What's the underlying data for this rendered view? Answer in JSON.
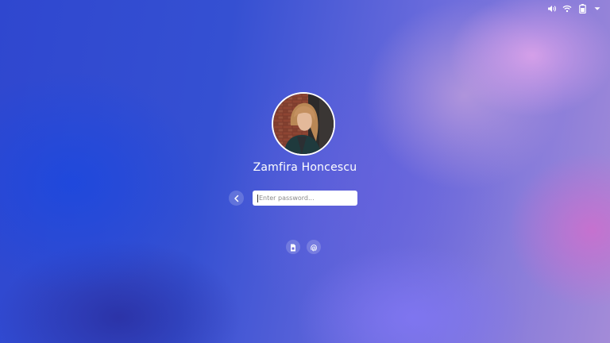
{
  "status_bar": {
    "icons": [
      "volume-icon",
      "wifi-icon",
      "battery-icon",
      "chevron-down-icon"
    ]
  },
  "user": {
    "name": "Zamfira Honcescu"
  },
  "login": {
    "password_placeholder": "Enter password...",
    "password_value": ""
  },
  "auth_methods": [
    "smartcard-icon",
    "fingerprint-icon"
  ],
  "colors": {
    "background_blue": "#2f47cf",
    "background_violet": "#a38bd8",
    "accent_pink": "#cd6ecd",
    "text": "#ffffff",
    "field_bg": "#ffffff"
  }
}
